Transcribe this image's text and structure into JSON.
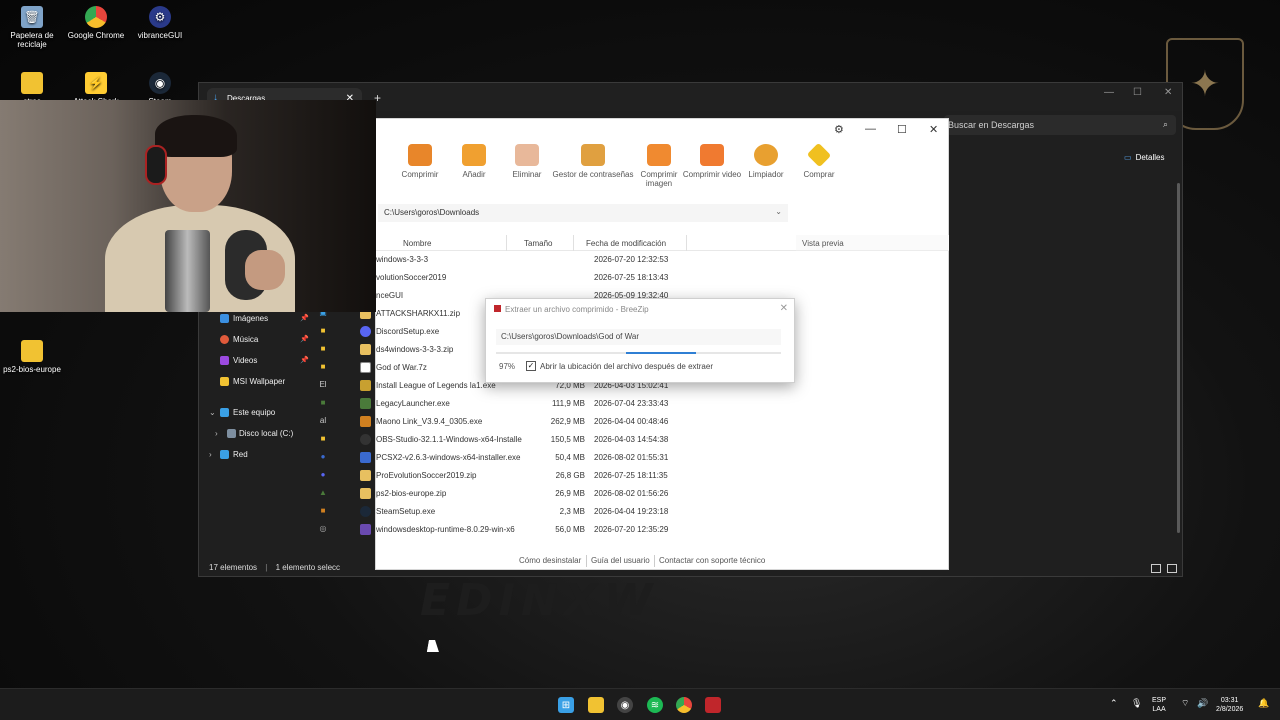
{
  "desktop": {
    "icons": [
      {
        "label": "Papelera de reciclaje",
        "icon": "recycle-bin-icon"
      },
      {
        "label": "Google Chrome",
        "icon": "chrome-icon"
      },
      {
        "label": "vibranceGUI",
        "icon": "vibrancegui-icon"
      },
      {
        "label": "otros",
        "icon": "folder-icon"
      },
      {
        "label": "Attack Shark",
        "icon": "attack-shark-icon"
      },
      {
        "label": "Steam",
        "icon": "steam-icon"
      },
      {
        "label": "ps2-bios-europe",
        "icon": "folder-icon"
      }
    ]
  },
  "explorer": {
    "tab_title": "Descargas",
    "search_placeholder": "Buscar en Descargas",
    "details_label": "Detalles",
    "nav": [
      {
        "label": "Imágenes",
        "color": "#3b8fe0"
      },
      {
        "label": "Música",
        "color": "#e05a3b"
      },
      {
        "label": "Videos",
        "color": "#9b4ae0"
      },
      {
        "label": "MSI Wallpaper",
        "color": "#f1c232"
      }
    ],
    "tree": [
      {
        "label": "Este equipo",
        "color": "#3aa0e6"
      },
      {
        "label": "Disco local (C:)",
        "color": "#7e8fa0"
      },
      {
        "label": "Red",
        "color": "#3aa0e6"
      }
    ],
    "side_letters": [
      "El",
      "al"
    ],
    "status": {
      "count": "17 elementos",
      "selection": "1 elemento selecc"
    }
  },
  "breezip": {
    "toolbar": [
      {
        "label": "Comprimir",
        "color": "#e8862a"
      },
      {
        "label": "Añadir",
        "color": "#f0a030"
      },
      {
        "label": "Eliminar",
        "color": "#e8b89a"
      },
      {
        "label": "Gestor de contraseñas",
        "color": "#e0a040"
      },
      {
        "label": "Comprimir imagen",
        "color": "#f08a30"
      },
      {
        "label": "Comprimir video",
        "color": "#f07a30"
      },
      {
        "label": "Limpiador",
        "color": "#e8a030"
      },
      {
        "label": "Comprar",
        "color": "#f0c020"
      }
    ],
    "path": "C:\\Users\\goros\\Downloads",
    "columns": {
      "name": "Nombre",
      "size": "Tamaño",
      "date": "Fecha de modificación"
    },
    "preview_label": "Vista previa",
    "files": [
      {
        "name": "windows-3-3-3",
        "size": "",
        "date": "2026-07-20 12:32:53",
        "color": "#f1c232"
      },
      {
        "name": "volutionSoccer2019",
        "size": "",
        "date": "2026-07-25 18:13:43",
        "color": "#f1c232"
      },
      {
        "name": "nceGUI",
        "size": "",
        "date": "2026-05-09 19:32:40",
        "color": "#f1c232"
      },
      {
        "name": "ATTACKSHARKX11.zip",
        "size": "",
        "date": "",
        "color": "#e8c060"
      },
      {
        "name": "DiscordSetup.exe",
        "size": "",
        "date": "",
        "color": "#5865f2"
      },
      {
        "name": "ds4windows-3-3-3.zip",
        "size": "",
        "date": "",
        "color": "#e8c060"
      },
      {
        "name": "God of War.7z",
        "size": "",
        "date": "",
        "color": "#dddddd"
      },
      {
        "name": "Install League of Legends la1.exe",
        "size": "72,0 MB",
        "date": "2026-04-03 15:02:41",
        "color": "#c8a030"
      },
      {
        "name": "LegacyLauncher.exe",
        "size": "111,9 MB",
        "date": "2026-07-04 23:33:43",
        "color": "#4a7a3a"
      },
      {
        "name": "Maono Link_V3.9.4_0305.exe",
        "size": "262,9 MB",
        "date": "2026-04-04 00:48:46",
        "color": "#d08020"
      },
      {
        "name": "OBS-Studio-32.1.1-Windows-x64-Installe",
        "size": "150,5 MB",
        "date": "2026-04-03 14:54:38",
        "color": "#333333"
      },
      {
        "name": "PCSX2-v2.6.3-windows-x64-installer.exe",
        "size": "50,4 MB",
        "date": "2026-08-02 01:55:31",
        "color": "#3a6ad0"
      },
      {
        "name": "ProEvolutionSoccer2019.zip",
        "size": "26,8 GB",
        "date": "2026-07-25 18:11:35",
        "color": "#e8c060"
      },
      {
        "name": "ps2-bios-europe.zip",
        "size": "26,9 MB",
        "date": "2026-08-02 01:56:26",
        "color": "#e8c060"
      },
      {
        "name": "SteamSetup.exe",
        "size": "2,3 MB",
        "date": "2026-04-04 19:23:18",
        "color": "#1b2838"
      },
      {
        "name": "windowsdesktop-runtime-8.0.29-win-x6",
        "size": "56,0 MB",
        "date": "2026-07-20 12:35:29",
        "color": "#6a4ab0"
      }
    ],
    "footer": [
      "Cómo desinstalar",
      "Guía del usuario",
      "Contactar con soporte técnico"
    ]
  },
  "dialog": {
    "title": "Extraer un archivo comprimido - BreeZip",
    "path": "C:\\Users\\goros\\Downloads\\God of War",
    "progress_percent": 97,
    "percent_label": "97%",
    "checkbox_label": "Abrir la ubicación del archivo después de extraer",
    "checked": true
  },
  "taskbar": {
    "apps": [
      {
        "icon": "windows-start-icon",
        "color": "#3aa0e6"
      },
      {
        "icon": "file-explorer-icon",
        "color": "#f1c232"
      },
      {
        "icon": "obs-icon",
        "color": "#444444"
      },
      {
        "icon": "spotify-icon",
        "color": "#1db954"
      },
      {
        "icon": "chrome-icon",
        "color": "#e8453c"
      },
      {
        "icon": "breezip-icon",
        "color": "#c0262b"
      }
    ],
    "lang": "ESP",
    "lang_sub": "LAA",
    "time": "03:31",
    "date": "2/8/2026"
  }
}
